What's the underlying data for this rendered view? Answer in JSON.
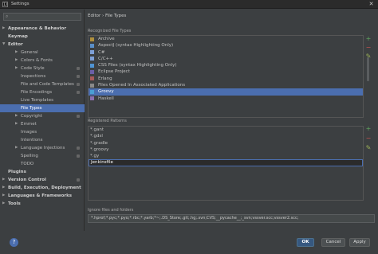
{
  "window": {
    "title": "Settings",
    "app_icon_text": "IJ"
  },
  "sidebar": {
    "search_placeholder": "",
    "items": [
      {
        "label": "Appearance & Behavior",
        "level": 0,
        "expandable": true,
        "bold": true
      },
      {
        "label": "Keymap",
        "level": 0,
        "expandable": false,
        "bold": true
      },
      {
        "label": "Editor",
        "level": 0,
        "expandable": true,
        "expanded": true,
        "bold": true
      },
      {
        "label": "General",
        "level": 1,
        "expandable": true
      },
      {
        "label": "Colors & Fonts",
        "level": 1,
        "expandable": true
      },
      {
        "label": "Code Style",
        "level": 1,
        "expandable": true,
        "project": true
      },
      {
        "label": "Inspections",
        "level": 1,
        "project": true
      },
      {
        "label": "File and Code Templates",
        "level": 1,
        "project": true
      },
      {
        "label": "File Encodings",
        "level": 1,
        "project": true
      },
      {
        "label": "Live Templates",
        "level": 1
      },
      {
        "label": "File Types",
        "level": 1,
        "selected": true
      },
      {
        "label": "Copyright",
        "level": 1,
        "expandable": true,
        "project": true
      },
      {
        "label": "Emmet",
        "level": 1,
        "expandable": true
      },
      {
        "label": "Images",
        "level": 1
      },
      {
        "label": "Intentions",
        "level": 1
      },
      {
        "label": "Language Injections",
        "level": 1,
        "expandable": true,
        "project": true
      },
      {
        "label": "Spelling",
        "level": 1,
        "project": true
      },
      {
        "label": "TODO",
        "level": 1
      },
      {
        "label": "Plugins",
        "level": 0,
        "bold": true
      },
      {
        "label": "Version Control",
        "level": 0,
        "expandable": true,
        "bold": true,
        "project": true
      },
      {
        "label": "Build, Execution, Deployment",
        "level": 0,
        "expandable": true,
        "bold": true
      },
      {
        "label": "Languages & Frameworks",
        "level": 0,
        "expandable": true,
        "bold": true
      },
      {
        "label": "Tools",
        "level": 0,
        "expandable": true,
        "bold": true
      }
    ]
  },
  "breadcrumb": {
    "text": "Editor › File Types"
  },
  "recognized": {
    "title": "Recognized File Types",
    "items": [
      {
        "label": "Archive",
        "icon": "archive-icon",
        "color": "#b0903d"
      },
      {
        "label": "AspectJ (syntax Highlighting Only)",
        "icon": "aspectj-icon",
        "color": "#5a8fc9"
      },
      {
        "label": "C#",
        "icon": "csharp-icon",
        "color": "#7d9fd6"
      },
      {
        "label": "C/C++",
        "icon": "cpp-icon",
        "color": "#7d9fd6"
      },
      {
        "label": "CSS Files (syntax Highlighting Only)",
        "icon": "css-icon",
        "color": "#4f94d4"
      },
      {
        "label": "Eclipse Project",
        "icon": "eclipse-icon",
        "color": "#6b5fa8"
      },
      {
        "label": "Erlang",
        "icon": "erlang-icon",
        "color": "#a85a5a"
      },
      {
        "label": "Files Opened In Associated Applications",
        "icon": "external-file-icon",
        "color": "#8a8a8a"
      },
      {
        "label": "Groovy",
        "icon": "groovy-icon",
        "color": "#4a9fd4",
        "selected": true
      },
      {
        "label": "Haskell",
        "icon": "haskell-icon",
        "color": "#8a6fb0"
      }
    ]
  },
  "patterns": {
    "title": "Registered Patterns",
    "items": [
      {
        "label": "*.gant"
      },
      {
        "label": "*.gdsl"
      },
      {
        "label": "*.gradle"
      },
      {
        "label": "*.groovy"
      },
      {
        "label": "*.gy"
      },
      {
        "label": "Jenkinsfile",
        "editing": true
      }
    ]
  },
  "ignore": {
    "title": "Ignore files and folders",
    "value": "*.hprof;*.pyc;*.pyo;*.rbc;*.yarb;*~;.DS_Store;.git;.hg;.svn;CVS;__pycache__;_svn;vssver.scc;vssver2.scc;"
  },
  "buttons": {
    "ok": "OK",
    "cancel": "Cancel",
    "apply": "Apply",
    "help": "?"
  },
  "side_buttons": {
    "add": "+",
    "remove": "−",
    "edit": "✎"
  },
  "colors": {
    "accent": "#4b6eaf",
    "add": "#5fa65f",
    "remove": "#c75450",
    "edit": "#9ab058"
  }
}
